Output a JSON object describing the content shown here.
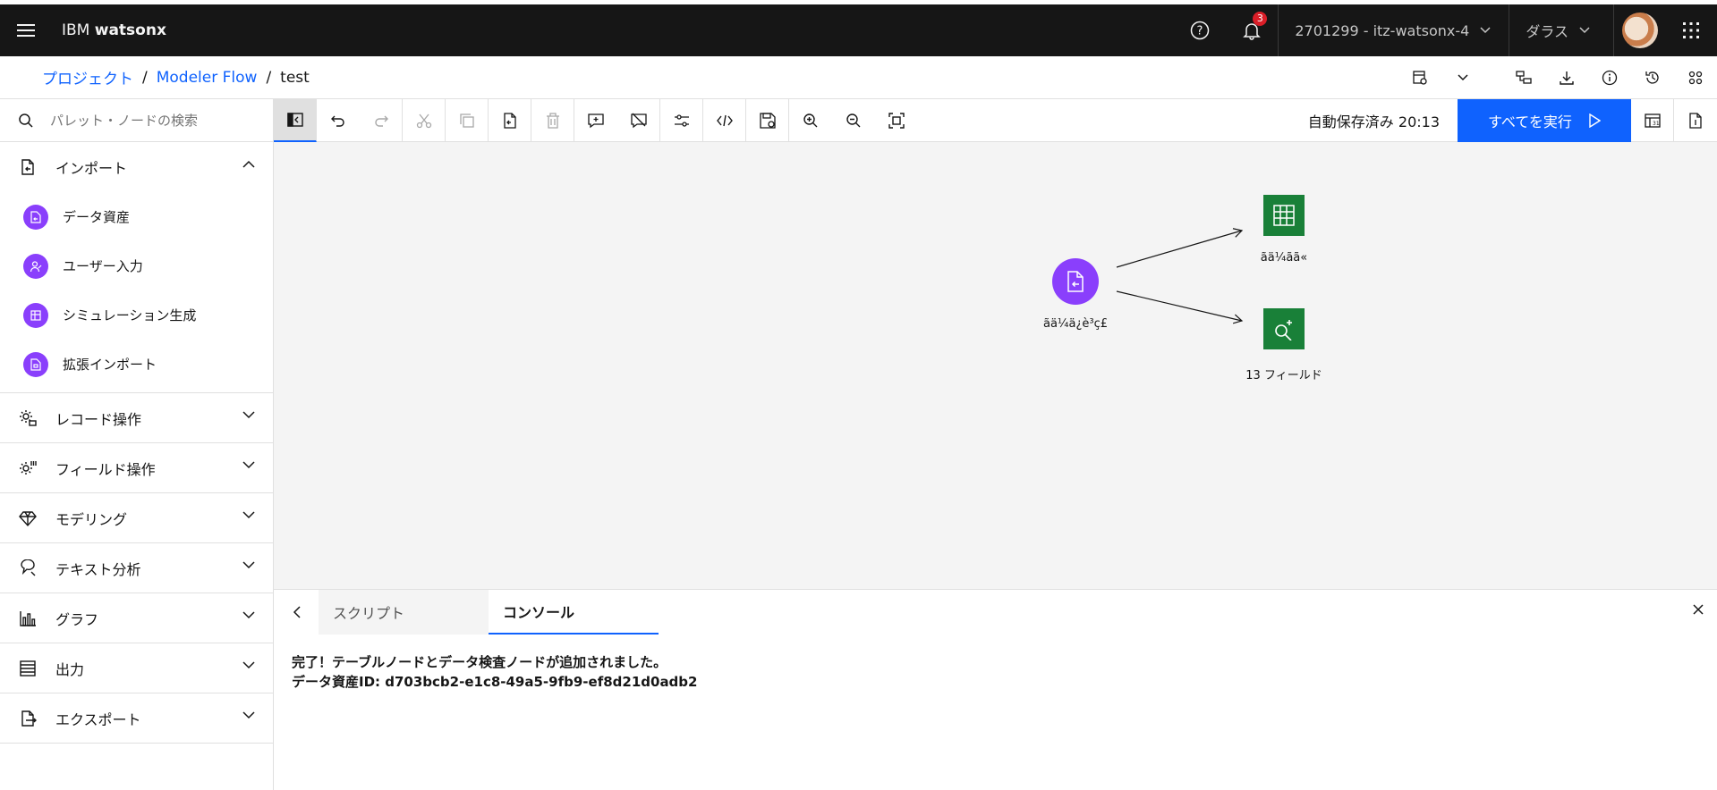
{
  "header": {
    "brand_prefix": "IBM",
    "brand_name": "watsonx",
    "notification_count": "3",
    "account": "2701299 - itz-watsonx-4",
    "region": "ダラス"
  },
  "breadcrumb": {
    "project": "プロジェクト",
    "flow": "Modeler Flow",
    "current": "test",
    "separator": "/"
  },
  "sidebar": {
    "search_placeholder": "パレット・ノードの検索",
    "import_label": "インポート",
    "import_items": [
      {
        "label": "データ資産"
      },
      {
        "label": "ユーザー入力"
      },
      {
        "label": "シミュレーション生成"
      },
      {
        "label": "拡張インポート"
      }
    ],
    "categories": [
      {
        "label": "レコード操作"
      },
      {
        "label": "フィールド操作"
      },
      {
        "label": "モデリング"
      },
      {
        "label": "テキスト分析"
      },
      {
        "label": "グラフ"
      },
      {
        "label": "出力"
      },
      {
        "label": "エクスポート"
      }
    ]
  },
  "toolbar": {
    "autosave": "自動保存済み 20:13",
    "run_all": "すべてを実行"
  },
  "canvas": {
    "nodes": [
      {
        "label": "ãä¼ä¿è³ç£",
        "color": "#8a3ffc"
      },
      {
        "label": "ãä¼ãã«",
        "color": "#198038"
      },
      {
        "label": "13 フィールド",
        "color": "#198038"
      }
    ]
  },
  "panel": {
    "tab_script": "スクリプト",
    "tab_console": "コンソール",
    "console_line1": "完了！テーブルノードとデータ検査ノードが追加されました。",
    "console_line2": "データ資産ID: d703bcb2-e1c8-49a5-9fb9-ef8d21d0adb2"
  }
}
